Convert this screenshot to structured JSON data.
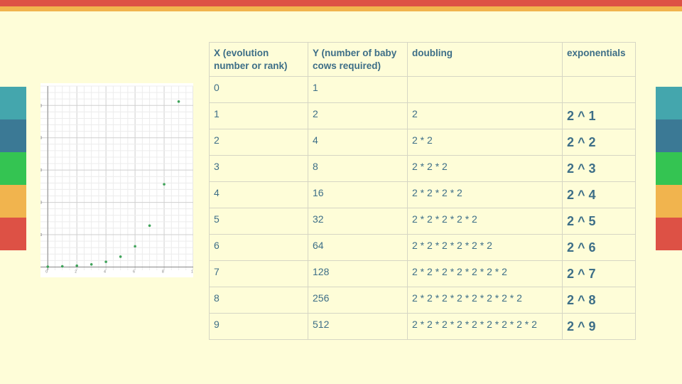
{
  "decor": {
    "top_colors": [
      "#dd5145",
      "#f1b44e"
    ],
    "side_colors": [
      "#44a6ad",
      "#3b7995",
      "#34c452",
      "#f1b44e",
      "#dd5145"
    ]
  },
  "table": {
    "headers": [
      "X (evolution number or rank)",
      "Y (number of baby cows required)",
      "doubling",
      "exponentials"
    ],
    "rows": [
      {
        "x": "0",
        "y": "1",
        "doubling": "",
        "exponential": ""
      },
      {
        "x": "1",
        "y": "2",
        "doubling": "2",
        "exponential": "2 ^ 1"
      },
      {
        "x": "2",
        "y": "4",
        "doubling": "2 * 2",
        "exponential": "2 ^ 2"
      },
      {
        "x": "3",
        "y": "8",
        "doubling": "2 * 2 * 2",
        "exponential": "2 ^ 3"
      },
      {
        "x": "4",
        "y": "16",
        "doubling": "2 * 2 * 2 * 2",
        "exponential": "2 ^ 4"
      },
      {
        "x": "5",
        "y": "32",
        "doubling": "2 * 2 * 2 * 2 * 2",
        "exponential": "2 ^ 5"
      },
      {
        "x": "6",
        "y": "64",
        "doubling": "2 * 2 * 2 * 2 * 2 * 2",
        "exponential": "2 ^ 6"
      },
      {
        "x": "7",
        "y": "128",
        "doubling": "2 * 2 * 2 * 2 * 2 * 2 * 2",
        "exponential": "2 ^ 7"
      },
      {
        "x": "8",
        "y": "256",
        "doubling": "2 * 2 * 2 * 2 * 2 * 2 * 2 * 2",
        "exponential": "2 ^ 8"
      },
      {
        "x": "9",
        "y": "512",
        "doubling": "2 * 2 * 2 * 2 * 2 * 2 * 2 * 2 * 2",
        "exponential": "2 ^ 9"
      }
    ]
  },
  "chart_data": {
    "type": "scatter",
    "x": [
      0,
      1,
      2,
      3,
      4,
      5,
      6,
      7,
      8,
      9
    ],
    "y": [
      1,
      2,
      4,
      8,
      16,
      32,
      64,
      128,
      256,
      512
    ],
    "x_ticks": [
      "0",
      "2",
      "4",
      "6",
      "8",
      "1"
    ],
    "x_tick_values": [
      0,
      2,
      4,
      6,
      8,
      10
    ],
    "y_ticks": [
      "100",
      "200",
      "300",
      "400",
      "500"
    ],
    "y_tick_values": [
      100,
      200,
      300,
      400,
      500
    ],
    "xlim": [
      -0.5,
      10
    ],
    "ylim": [
      -10,
      560
    ],
    "grid": true,
    "point_color": "#3fa35a"
  }
}
